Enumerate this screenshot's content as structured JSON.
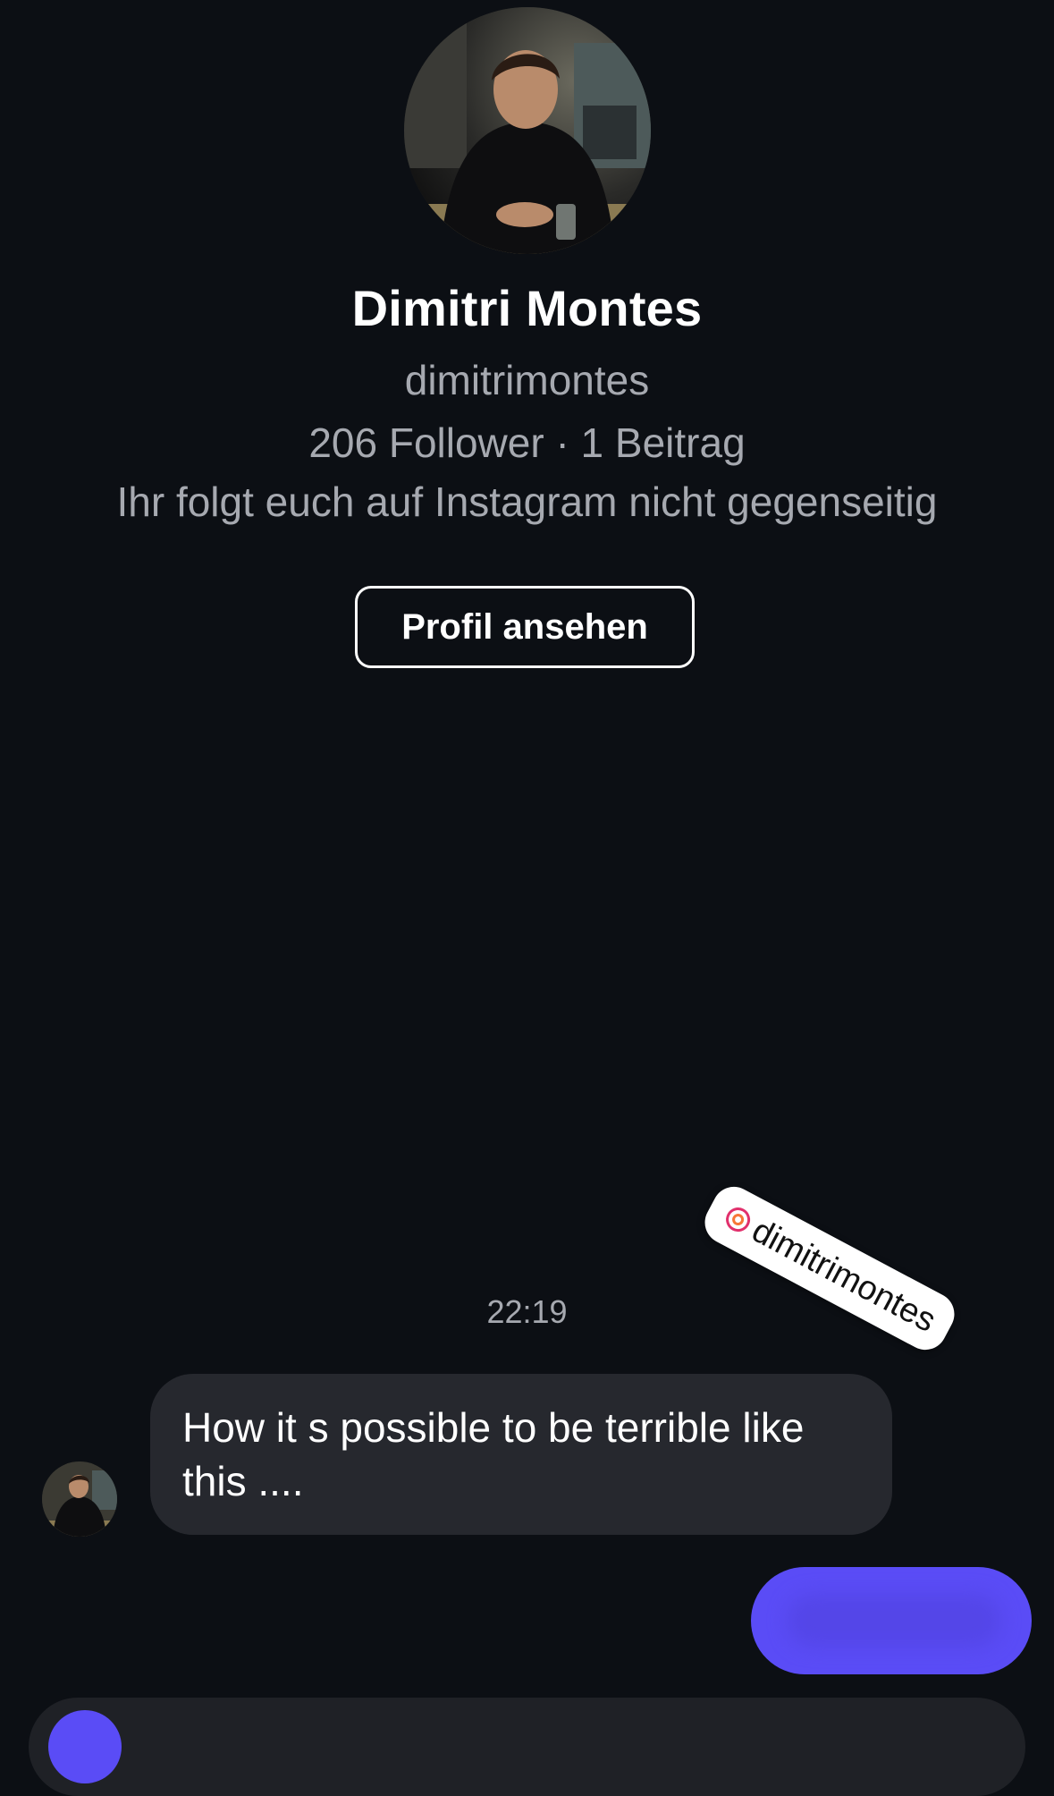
{
  "profile": {
    "name": "Dimitri Montes",
    "username": "dimitrimontes",
    "stats": "206 Follower · 1 Beitrag",
    "mutual_note": "Ihr folgt euch auf Instagram nicht gegenseitig",
    "view_profile_label": "Profil ansehen"
  },
  "sticker": {
    "text": "dimitrimontes",
    "icon": "threads-icon"
  },
  "chat": {
    "timestamp": "22:19",
    "incoming": {
      "text": "How it s possible to be terrible like this ...."
    },
    "outgoing": {
      "blurred": true
    }
  },
  "colors": {
    "background": "#0c0f14",
    "incoming_bubble": "#26282e",
    "outgoing_bubble": "#5a4cf6",
    "secondary_text": "#a6a9b0"
  }
}
